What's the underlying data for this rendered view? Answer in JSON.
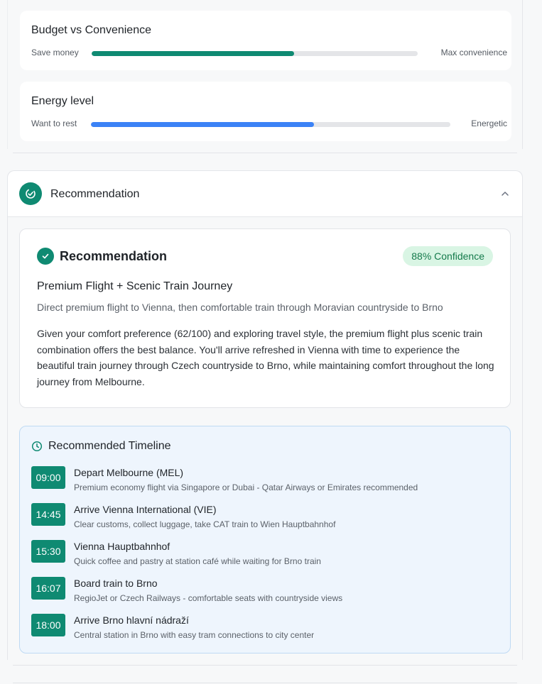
{
  "preferences": {
    "budget": {
      "title": "Budget vs Convenience",
      "left_label": "Save money",
      "right_label": "Max convenience",
      "value_fraction": 0.62,
      "color": "#0f8a72"
    },
    "energy": {
      "title": "Energy level",
      "left_label": "Want to rest",
      "right_label": "Energetic",
      "value_fraction": 0.62,
      "color": "#3b82f6"
    }
  },
  "section": {
    "title": "Recommendation",
    "icon": "check-circle-icon",
    "toggle_icon": "chevron-up-icon"
  },
  "recommendation": {
    "title": "Recommendation",
    "confidence": "88% Confidence",
    "option_title": "Premium Flight + Scenic Train Journey",
    "option_desc": "Direct premium flight to Vienna, then comfortable train through Moravian countryside to Brno",
    "reasoning": "Given your comfort preference (62/100) and exploring travel style, the premium flight plus scenic train combination offers the best balance. You'll arrive refreshed in Vienna with time to experience the beautiful train journey through Czech countryside to Brno, while maintaining comfort throughout the long journey from Melbourne."
  },
  "timeline": {
    "title": "Recommended Timeline",
    "icon": "clock-icon",
    "items": [
      {
        "time": "09:00",
        "title": "Depart Melbourne (MEL)",
        "desc": "Premium economy flight via Singapore or Dubai - Qatar Airways or Emirates recommended"
      },
      {
        "time": "14:45",
        "title": "Arrive Vienna International (VIE)",
        "desc": "Clear customs, collect luggage, take CAT train to Wien Hauptbahnhof"
      },
      {
        "time": "15:30",
        "title": "Vienna Hauptbahnhof",
        "desc": "Quick coffee and pastry at station café while waiting for Brno train"
      },
      {
        "time": "16:07",
        "title": "Board train to Brno",
        "desc": "RegioJet or Czech Railways - comfortable seats with countryside views"
      },
      {
        "time": "18:00",
        "title": "Arrive Brno hlavní nádraží",
        "desc": "Central station in Brno with easy tram connections to city center"
      }
    ]
  },
  "colors": {
    "accent": "#0f8a72",
    "blue": "#3b82f6",
    "confidence_bg": "#d9f5e4",
    "timeline_bg": "#eef5fd"
  }
}
